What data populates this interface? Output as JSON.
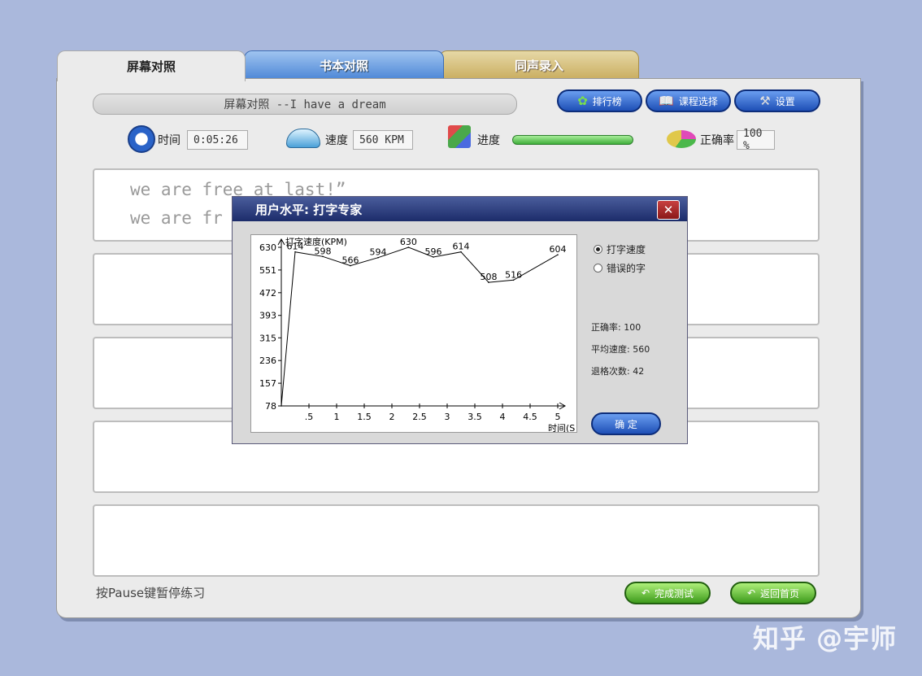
{
  "tabs": [
    {
      "label": "屏幕对照"
    },
    {
      "label": "书本对照"
    },
    {
      "label": "同声录入"
    }
  ],
  "header": {
    "title": "屏幕对照 --I have a dream",
    "buttons": [
      {
        "label": "排行榜",
        "icon": "butterfly-icon"
      },
      {
        "label": "课程选择",
        "icon": "book-icon"
      },
      {
        "label": "设置",
        "icon": "tools-icon"
      }
    ]
  },
  "stats": {
    "time_label": "时间",
    "time_value": "0:05:26",
    "speed_label": "速度",
    "speed_value": "560 KPM",
    "progress_label": "进度",
    "progress_fraction": 1.0,
    "accuracy_label": "正确率",
    "accuracy_value": "100 %"
  },
  "text_panel": {
    "lines": [
      "we are free at last!”",
      "we are fr"
    ]
  },
  "footer": {
    "hint": "按Pause键暂停练习",
    "finish_label": "完成测试",
    "home_label": "返回首页"
  },
  "dialog": {
    "title": "用户水平:  打字专家",
    "close_glyph": "✕",
    "options": [
      {
        "label": "打字速度",
        "selected": true
      },
      {
        "label": "错误的字",
        "selected": false
      }
    ],
    "accuracy": "正确率:  100",
    "avg_speed": "平均速度: 560",
    "backspaces": "退格次数: 42",
    "ok_label": "确 定"
  },
  "chart_data": {
    "type": "line",
    "ylabel": "打字速度(KPM)",
    "xlabel": "时间(S",
    "y_ticks": [
      78,
      157,
      236,
      315,
      393,
      472,
      551,
      630
    ],
    "x_ticks": [
      ".5",
      "1",
      "1.5",
      "2",
      "2.5",
      "3",
      "3.5",
      "4",
      "4.5",
      "5"
    ],
    "ylim": [
      78,
      630
    ],
    "series": [
      {
        "points": [
          {
            "x": 0.0,
            "y": 78
          },
          {
            "x": 0.25,
            "y": 614
          },
          {
            "x": 0.75,
            "y": 598
          },
          {
            "x": 1.25,
            "y": 566
          },
          {
            "x": 1.75,
            "y": 594
          },
          {
            "x": 2.3,
            "y": 630
          },
          {
            "x": 2.75,
            "y": 596
          },
          {
            "x": 3.25,
            "y": 614
          },
          {
            "x": 3.75,
            "y": 508
          },
          {
            "x": 4.2,
            "y": 516
          },
          {
            "x": 5.0,
            "y": 604
          }
        ],
        "labels": [
          {
            "x": 0.25,
            "y": 614,
            "text": "614"
          },
          {
            "x": 0.75,
            "y": 598,
            "text": "598"
          },
          {
            "x": 1.25,
            "y": 566,
            "text": "566"
          },
          {
            "x": 1.75,
            "y": 594,
            "text": "594"
          },
          {
            "x": 2.3,
            "y": 630,
            "text": "630"
          },
          {
            "x": 2.75,
            "y": 596,
            "text": "596"
          },
          {
            "x": 3.25,
            "y": 614,
            "text": "614"
          },
          {
            "x": 3.75,
            "y": 508,
            "text": "508"
          },
          {
            "x": 4.2,
            "y": 516,
            "text": "516"
          },
          {
            "x": 5.0,
            "y": 604,
            "text": "604"
          }
        ]
      }
    ]
  },
  "watermark": "知乎 @宇师",
  "colors": {
    "background": "#aab8dc",
    "blue_button": "#1e4fb6",
    "green_button": "#3e9b1c",
    "dialog_title": "#1c2c6a"
  }
}
